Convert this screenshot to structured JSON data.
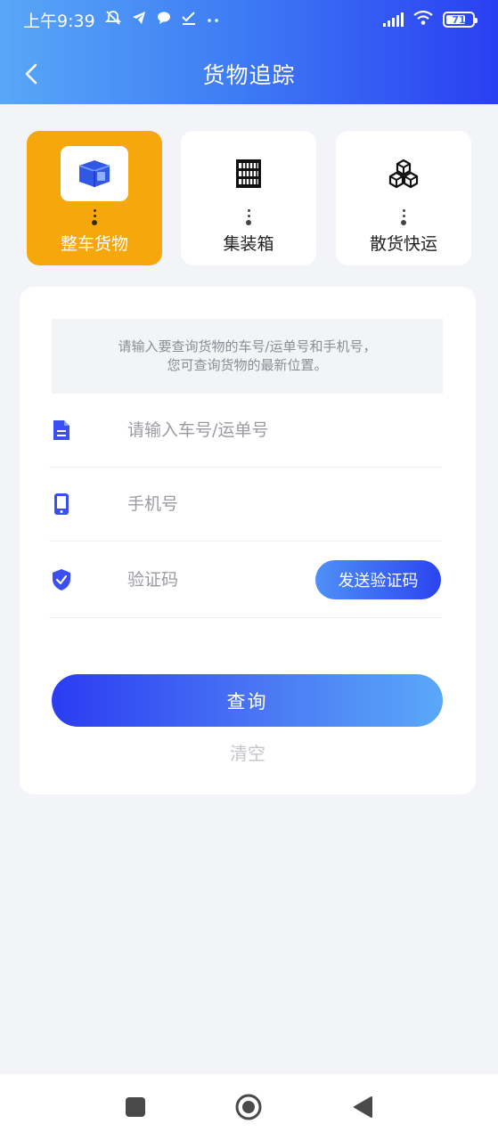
{
  "status_bar": {
    "time": "上午9:39",
    "icons_left": [
      "bell-off-icon",
      "telegram-icon",
      "chat-icon",
      "check-icon",
      "more-icon"
    ],
    "battery": "71"
  },
  "header": {
    "title": "货物追踪",
    "back_icon": "chevron-left-icon"
  },
  "tabs": [
    {
      "label": "整车货物",
      "icon": "box-icon",
      "active": true
    },
    {
      "label": "集装箱",
      "icon": "container-icon",
      "active": false
    },
    {
      "label": "散货快运",
      "icon": "cubes-icon",
      "active": false
    }
  ],
  "form": {
    "tip_line1": "请输入要查询货物的车号/运单号和手机号，",
    "tip_line2": "您可查询货物的最新位置。",
    "waybill_placeholder": "请输入车号/运单号",
    "phone_placeholder": "手机号",
    "code_placeholder": "验证码",
    "send_code_label": "发送验证码",
    "query_label": "查询",
    "clear_label": "清空"
  },
  "colors": {
    "accent_blue": "#2b44f0",
    "active_tab": "#f6a70b"
  }
}
